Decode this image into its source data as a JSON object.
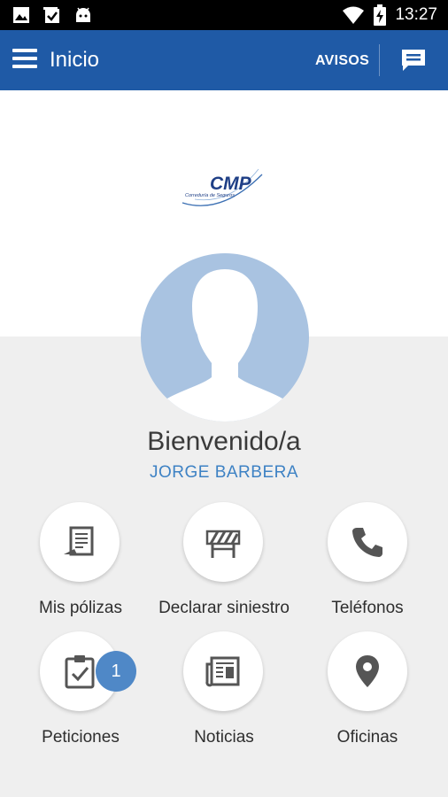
{
  "status_bar": {
    "time": "13:27",
    "left_icons": [
      "image-icon",
      "checklist-icon",
      "android-icon"
    ],
    "right_icons": [
      "wifi-icon",
      "battery-icon"
    ]
  },
  "app_bar": {
    "title": "Inicio",
    "avisos_label": "AVISOS",
    "background_color": "#1f5aa6"
  },
  "logo": {
    "text": "CMP",
    "subtitle": "Correduría de Seguros"
  },
  "profile": {
    "welcome": "Bienvenido/a",
    "name": "JORGE BARBERA"
  },
  "menu": [
    {
      "label": "Mis pólizas",
      "icon": "policy-document-icon"
    },
    {
      "label": "Declarar siniestro",
      "icon": "road-barrier-icon"
    },
    {
      "label": "Teléfonos",
      "icon": "phone-icon"
    },
    {
      "label": "Peticiones",
      "icon": "clipboard-check-icon",
      "badge": "1"
    },
    {
      "label": "Noticias",
      "icon": "newspaper-icon"
    },
    {
      "label": "Oficinas",
      "icon": "location-pin-icon"
    }
  ]
}
